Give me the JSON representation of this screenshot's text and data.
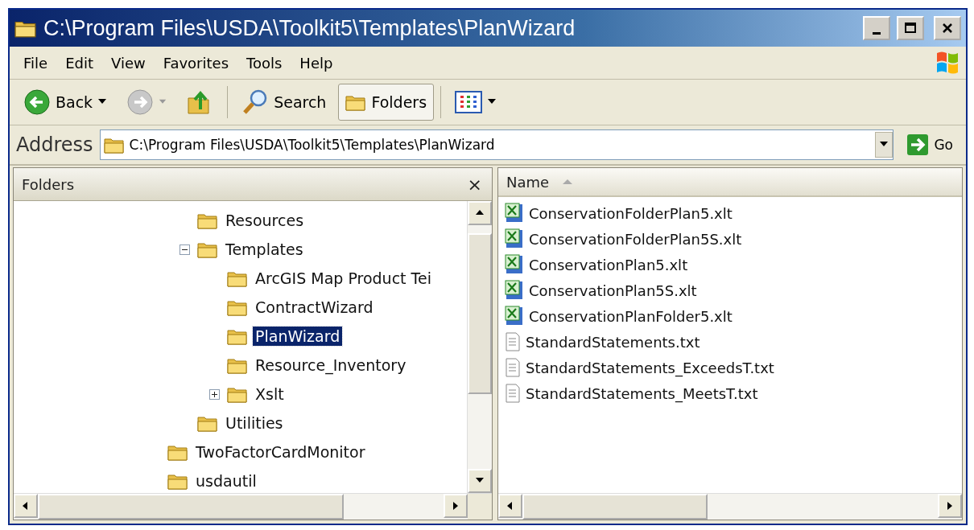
{
  "window": {
    "title": "C:\\Program Files\\USDA\\Toolkit5\\Templates\\PlanWizard"
  },
  "menu": [
    "File",
    "Edit",
    "View",
    "Favorites",
    "Tools",
    "Help"
  ],
  "toolbar": {
    "back": {
      "label": "Back",
      "disabled": false
    },
    "forward": {
      "disabled": true
    },
    "search": {
      "label": "Search"
    },
    "folders": {
      "label": "Folders",
      "pressed": true
    }
  },
  "address": {
    "label": "Address",
    "value": "C:\\Program Files\\USDA\\Toolkit5\\Templates\\PlanWizard",
    "go": "Go"
  },
  "folders_pane": {
    "title": "Folders",
    "close": "×",
    "tree": [
      {
        "children": [
          {
            "label": "Resources",
            "selected": false
          },
          {
            "label": "Templates",
            "selected": false,
            "expanded": true,
            "children": [
              {
                "label": "ArcGIS Map Product Tei",
                "selected": false
              },
              {
                "label": "ContractWizard",
                "selected": false
              },
              {
                "label": "PlanWizard",
                "selected": true
              },
              {
                "label": "Resource_Inventory",
                "selected": false
              },
              {
                "label": "Xslt",
                "selected": false,
                "expanded": false
              }
            ]
          },
          {
            "label": "Utilities",
            "selected": false
          }
        ]
      },
      {
        "label": "TwoFactorCardMonitor",
        "selected": false
      },
      {
        "label": "usdautil",
        "selected": false
      }
    ]
  },
  "file_list": {
    "columns": [
      {
        "label": "Name",
        "sorted": true
      }
    ],
    "files": [
      {
        "name": "ConservationFolderPlan5.xlt",
        "kind": "excel"
      },
      {
        "name": "ConservationFolderPlan5S.xlt",
        "kind": "excel"
      },
      {
        "name": "ConservationPlan5.xlt",
        "kind": "excel"
      },
      {
        "name": "ConservationPlan5S.xlt",
        "kind": "excel"
      },
      {
        "name": "ConservationPlanFolder5.xlt",
        "kind": "excel"
      },
      {
        "name": "StandardStatements.txt",
        "kind": "text"
      },
      {
        "name": "StandardStatements_ExceedsT.txt",
        "kind": "text"
      },
      {
        "name": "StandardStatements_MeetsT.txt",
        "kind": "text"
      }
    ]
  }
}
